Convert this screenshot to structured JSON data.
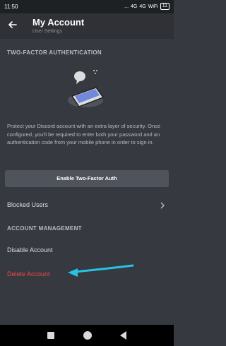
{
  "status_bar": {
    "time": "11:50",
    "signal_text": "...",
    "network_1": "4G",
    "network_2": "4G",
    "wifi_label": "WiFi",
    "battery": "11"
  },
  "header": {
    "title": "My Account",
    "subtitle": "User Settings",
    "back_icon": "back-arrow-icon"
  },
  "two_factor": {
    "section_title": "TWO-FACTOR AUTHENTICATION",
    "illustration_icon": "phone-chat-illustration",
    "description": "Protect your Discord account with an extra layer of security. Once configured, you'll be required to enter both your password and an authentication code from your mobile phone in order to sign in.",
    "enable_button": "Enable Two-Factor Auth"
  },
  "blocked_users": {
    "label": "Blocked Users",
    "chevron_icon": "chevron-right-icon"
  },
  "account_management": {
    "section_title": "ACCOUNT MANAGEMENT",
    "disable_account": "Disable Account",
    "delete_account": "Delete Account"
  },
  "colors": {
    "background": "#36393f",
    "header": "#2f3136",
    "button": "#4f545c",
    "danger": "#f04747",
    "annotation_arrow": "#27c2e6"
  },
  "annotation": {
    "arrow_icon": "annotation-arrow-icon"
  }
}
